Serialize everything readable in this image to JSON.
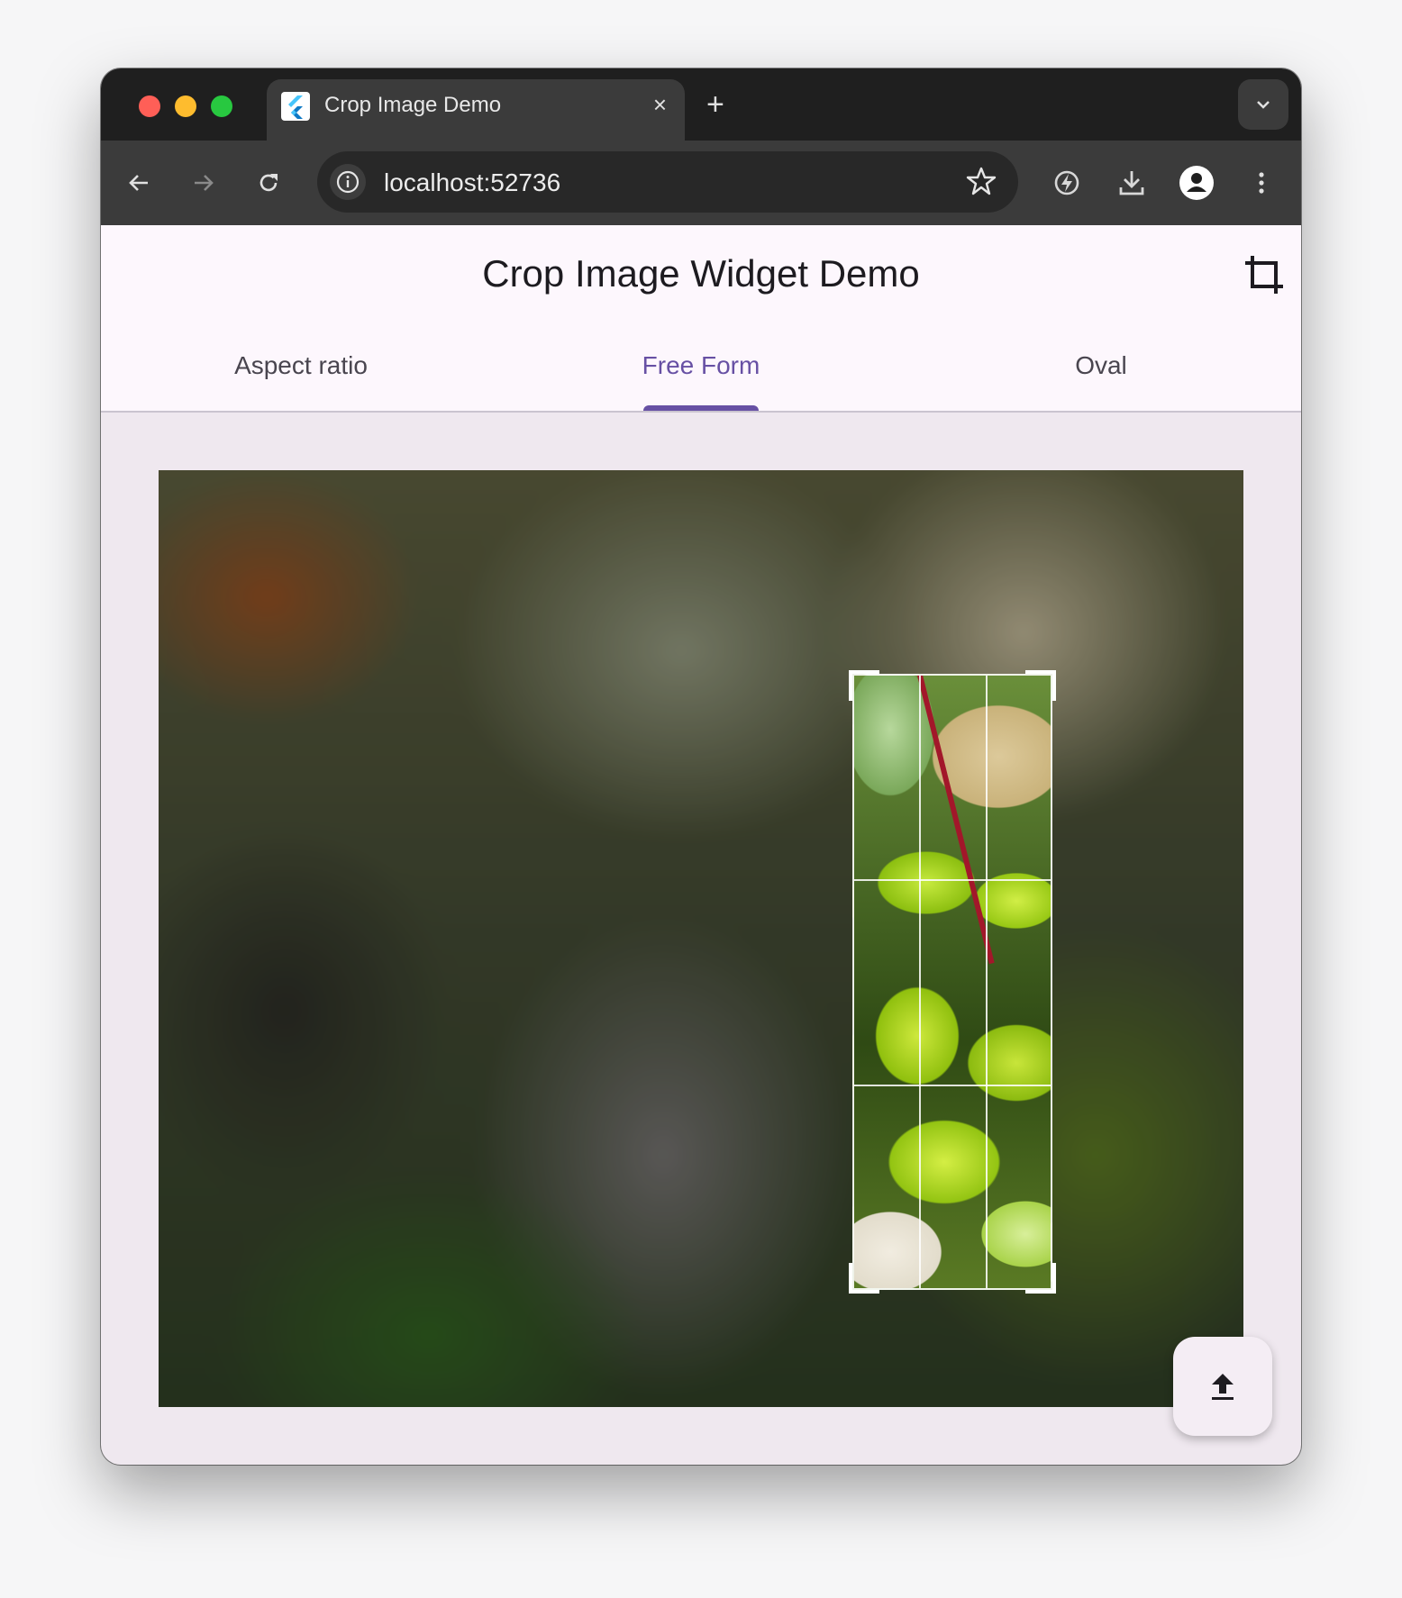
{
  "browser": {
    "tab_title": "Crop Image Demo",
    "tab_close": "×",
    "new_tab": "+",
    "url": "localhost:52736"
  },
  "app": {
    "title": "Crop Image Widget Demo",
    "tabs": [
      {
        "label": "Aspect ratio",
        "selected": false
      },
      {
        "label": "Free Form",
        "selected": true
      },
      {
        "label": "Oval",
        "selected": false
      }
    ],
    "accent_color": "#6750a4"
  },
  "icons": {
    "back": "back-arrow-icon",
    "forward": "forward-arrow-icon",
    "reload": "reload-icon",
    "site_info": "info-icon",
    "bookmark": "star-icon",
    "extension": "performance-icon",
    "downloads": "download-icon",
    "profile": "profile-icon",
    "menu": "more-vert-icon",
    "crop_action": "crop-icon",
    "upload": "upload-icon"
  }
}
